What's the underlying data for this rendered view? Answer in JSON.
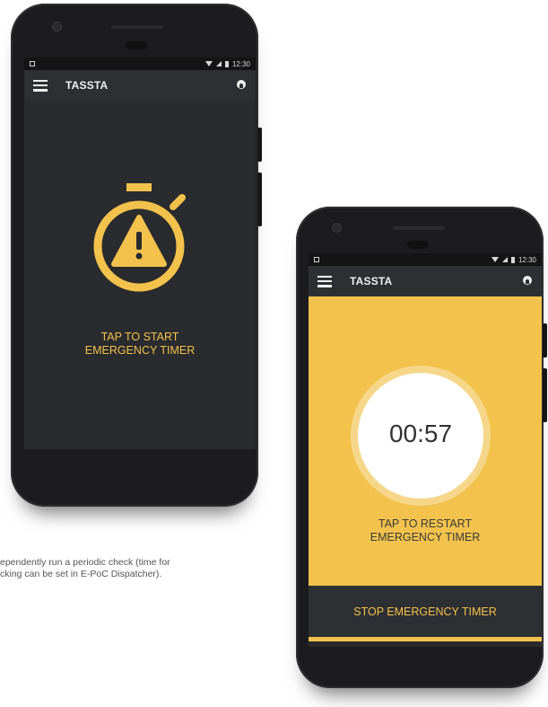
{
  "phone_left": {
    "status_time": "12:30",
    "app_title": "TASSTA",
    "prompt_line1": "TAP TO START",
    "prompt_line2": "EMERGENCY TIMER"
  },
  "phone_right": {
    "status_time": "12:30",
    "app_title": "TASSTA",
    "timer_value": "00:57",
    "prompt_line1": "TAP TO RESTART",
    "prompt_line2": "EMERGENCY TIMER",
    "stop_button_label": "STOP EMERGENCY TIMER"
  },
  "caption": {
    "line1": "ependently run a periodic check (time for",
    "line2": "cking can be set in E-PoC Dispatcher)."
  },
  "colors": {
    "accent_yellow": "#f2c24c",
    "screen_dark": "#2a2b2e",
    "bezel": "#1c1c1e"
  },
  "icons": [
    "menu-icon",
    "account-icon",
    "stopwatch-warning-icon"
  ]
}
